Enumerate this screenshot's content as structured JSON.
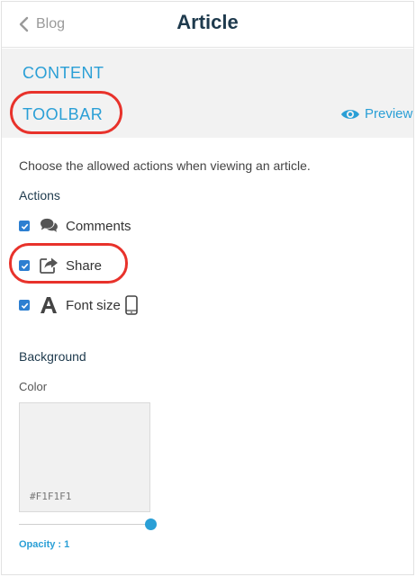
{
  "header": {
    "back_label": "Blog",
    "title": "Article"
  },
  "tabs": {
    "content": "CONTENT",
    "toolbar": "TOOLBAR"
  },
  "preview_label": "Preview",
  "description": "Choose the allowed actions when viewing an article.",
  "actions": {
    "heading": "Actions",
    "items": [
      {
        "label": "Comments",
        "icon": "comments-icon",
        "checked": true
      },
      {
        "label": "Share",
        "icon": "share-icon",
        "checked": true
      },
      {
        "label": "Font size",
        "icon": "font-size-icon",
        "checked": true
      }
    ]
  },
  "background": {
    "heading": "Background",
    "color_label": "Color",
    "color_value": "#F1F1F1",
    "opacity_label": "Opacity :",
    "opacity_value": "1",
    "opacity_fraction": 1
  },
  "colors": {
    "accent": "#2a9fd6",
    "title": "#1e3a4d",
    "highlight": "#e8322b",
    "checkbox": "#2d7fd1"
  }
}
